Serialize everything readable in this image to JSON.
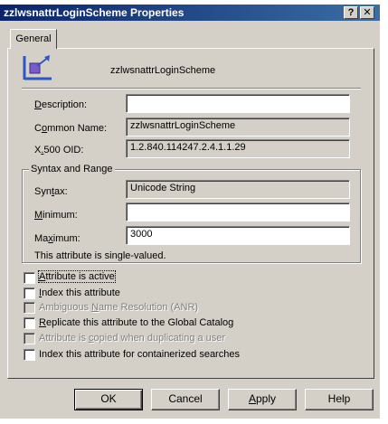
{
  "window": {
    "title": "zzlwsnattrLoginScheme Properties",
    "help_btn": "?",
    "close_btn": "✕"
  },
  "tabs": [
    {
      "label": "General",
      "active": true
    }
  ],
  "header": {
    "name": "zzlwsnattrLoginScheme",
    "icon": "attribute-schema-icon"
  },
  "fields": {
    "description": {
      "label_pre": "",
      "label_ul": "D",
      "label_post": "escription:",
      "value": ""
    },
    "common_name": {
      "label_pre": "C",
      "label_ul": "o",
      "label_post": "mmon Name:",
      "value": "zzlwsnattrLoginScheme"
    },
    "x500_oid": {
      "label_pre": "X",
      "label_ul": ".",
      "label_post": "500 OID:",
      "value": "1.2.840.114247.2.4.1.1.29"
    }
  },
  "syntax_group": {
    "title": "Syntax and Range",
    "syntax": {
      "label_pre": "Syn",
      "label_ul": "t",
      "label_post": "ax:",
      "value": "Unicode String"
    },
    "minimum": {
      "label_pre": "",
      "label_ul": "M",
      "label_post": "inimum:",
      "value": ""
    },
    "maximum": {
      "label_pre": "Ma",
      "label_ul": "x",
      "label_post": "imum:",
      "value": "3000"
    },
    "note": "This attribute is single-valued."
  },
  "checkboxes": [
    {
      "pre": "",
      "ul": "A",
      "post": "ttribute is active",
      "checked": false,
      "enabled": true,
      "focused": true
    },
    {
      "pre": "",
      "ul": "I",
      "post": "ndex this attribute",
      "checked": false,
      "enabled": true
    },
    {
      "pre": "Ambiguous ",
      "ul": "N",
      "post": "ame Resolution (ANR)",
      "checked": false,
      "enabled": false
    },
    {
      "pre": "",
      "ul": "R",
      "post": "eplicate this attribute to the Global Catalog",
      "checked": false,
      "enabled": true
    },
    {
      "pre": "Attribute is ",
      "ul": "c",
      "post": "opied when duplicating a user",
      "checked": false,
      "enabled": false
    },
    {
      "pre": "Index this attribute for containerized searches",
      "ul": "",
      "post": "",
      "checked": false,
      "enabled": true
    }
  ],
  "buttons": {
    "ok": "OK",
    "cancel": "Cancel",
    "apply_ul": "A",
    "apply_post": "pply",
    "help": "Help"
  },
  "colors": {
    "title_start": "#0a246a",
    "title_end": "#3a6ea5",
    "face": "#d4d0c8",
    "icon_blue": "#2b57c4",
    "icon_purple": "#7a5cc8"
  }
}
